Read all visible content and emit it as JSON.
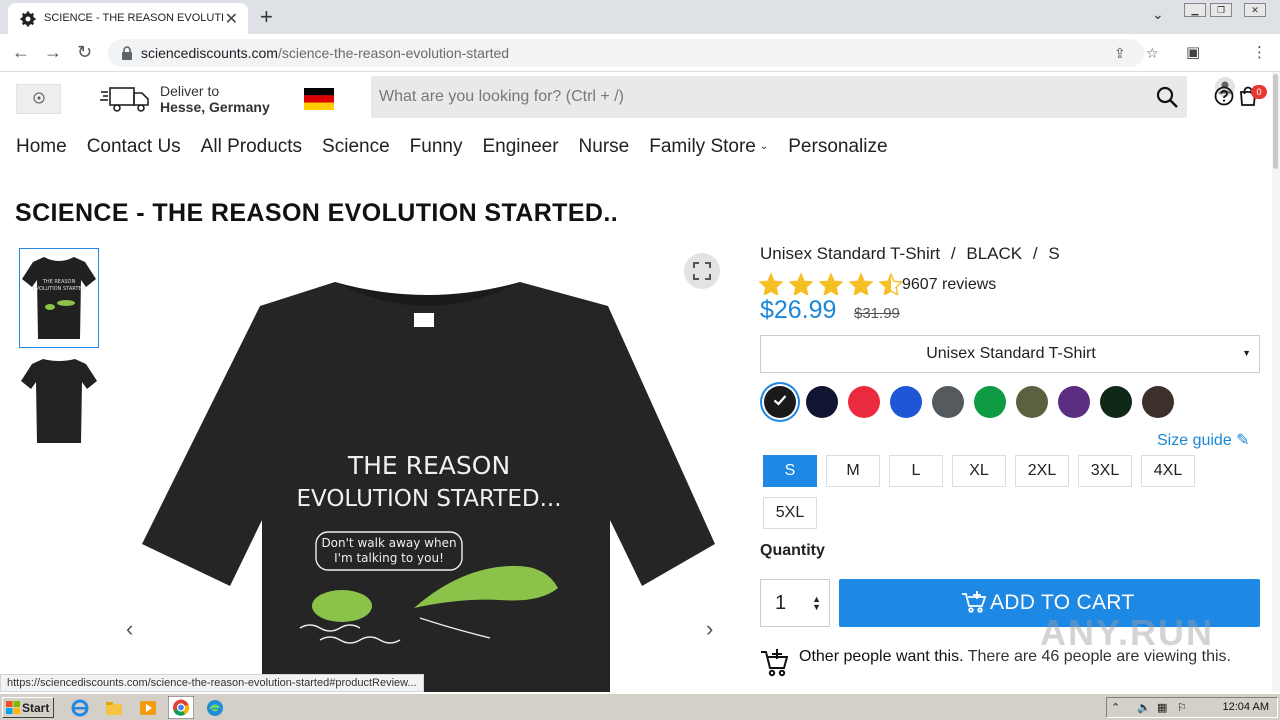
{
  "browser": {
    "tab_title": "SCIENCE - THE REASON EVOLUTION",
    "tab_close": "✕",
    "new_tab": "+",
    "url_domain": "sciencediscounts.com",
    "url_path": "/science-the-reason-evolution-started"
  },
  "header": {
    "deliver_line1": "Deliver to",
    "deliver_line2": "Hesse, Germany",
    "search_placeholder": "What are you looking for? (Ctrl + /)",
    "cart_count": "0"
  },
  "nav": {
    "items": [
      "Home",
      "Contact Us",
      "All Products",
      "Science",
      "Funny",
      "Engineer",
      "Nurse",
      "Family Store",
      "Personalize"
    ]
  },
  "product": {
    "title": "SCIENCE - THE REASON EVOLUTION STARTED..",
    "variant_style": "Unisex Standard T-Shirt",
    "variant_sep": "/",
    "variant_color": "BLACK",
    "variant_size": "S",
    "rating": 4.5,
    "reviews": "9607 reviews",
    "price": "$26.99",
    "old_price": "$31.99",
    "style_select": "Unisex Standard T-Shirt",
    "shirt_text_line1": "THE REASON",
    "shirt_text_line2": "EVOLUTION STARTED...",
    "speech_line1": "Don't walk away when",
    "speech_line2": "I'm talking to you!",
    "colors": [
      "#1a1a1a",
      "#101632",
      "#ea2a3e",
      "#1f56d6",
      "#555a5f",
      "#0f9a44",
      "#5a6040",
      "#5a2d80",
      "#102818",
      "#3d2f2c"
    ],
    "selected_color_index": 0,
    "size_guide": "Size guide",
    "sizes": [
      "S",
      "M",
      "L",
      "XL",
      "2XL",
      "3XL",
      "4XL",
      "5XL"
    ],
    "selected_size": "S",
    "quantity_label": "Quantity",
    "quantity": "1",
    "add_to_cart": "ADD TO CART",
    "people_bold": "Other people want this.",
    "people_rest": " There are 46 people are viewing this."
  },
  "status_url": "https://sciencediscounts.com/science-the-reason-evolution-started#productReview...",
  "watermark": "ANY.RUN",
  "taskbar": {
    "start": "Start",
    "clock": "12:04 AM"
  },
  "colors": {
    "accent": "#1e88e5",
    "price": "#1a87d9",
    "star": "#f6bf26",
    "badge": "#e53935"
  }
}
